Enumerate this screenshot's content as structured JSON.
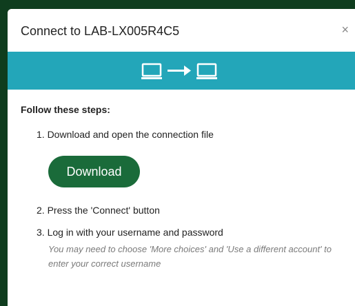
{
  "dialog": {
    "title": "Connect to LAB-LX005R4C5",
    "close_glyph": "×"
  },
  "banner": {
    "icons": [
      "laptop-icon",
      "arrow-right-icon",
      "laptop-icon"
    ],
    "color": "#23a6b9"
  },
  "instructions": {
    "heading": "Follow these steps:",
    "step1": "1. Download and open the connection file",
    "download_label": "Download",
    "step2": "2. Press the 'Connect' button",
    "step3": "3. Log in with your username and password",
    "note": "You may need to choose 'More choices' and 'Use a different account' to enter your correct username"
  },
  "colors": {
    "download_button": "#1a6b3a"
  }
}
